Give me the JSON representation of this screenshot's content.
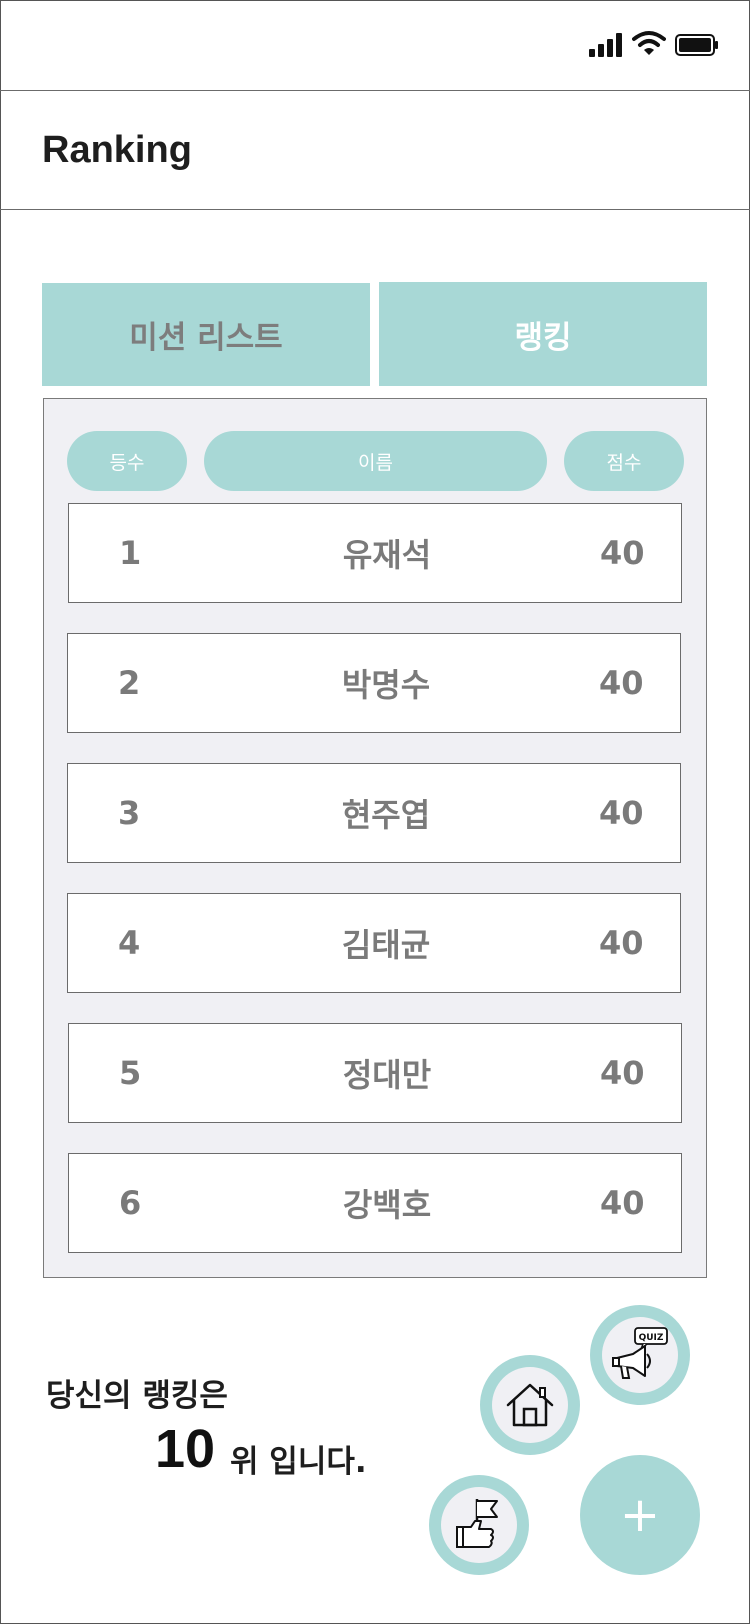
{
  "header": {
    "title": "Ranking"
  },
  "tabs": {
    "mission": "미션 리스트",
    "ranking": "랭킹"
  },
  "table": {
    "columns": {
      "rank": "등수",
      "name": "이름",
      "score": "점수"
    },
    "rows": [
      {
        "rank": "1",
        "name": "유재석",
        "score": "40"
      },
      {
        "rank": "2",
        "name": "박명수",
        "score": "40"
      },
      {
        "rank": "3",
        "name": "현주엽",
        "score": "40"
      },
      {
        "rank": "4",
        "name": "김태균",
        "score": "40"
      },
      {
        "rank": "5",
        "name": "정대만",
        "score": "40"
      },
      {
        "rank": "6",
        "name": "강백호",
        "score": "40"
      }
    ]
  },
  "my_rank": {
    "label": "당신의 랭킹은",
    "value": "10",
    "suffix": "위 입니다."
  },
  "fab": {
    "plus": "+",
    "quiz_badge": "QUIZ"
  },
  "colors": {
    "accent": "#a8d8d6",
    "panel_bg": "#f0f0f4",
    "text_gray": "#7a7a7a"
  }
}
